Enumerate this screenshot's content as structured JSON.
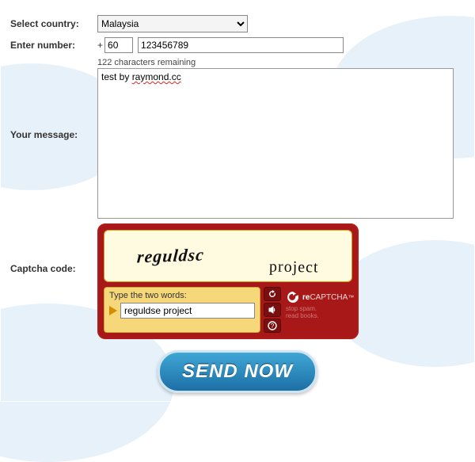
{
  "labels": {
    "country": "Select country:",
    "number": "Enter number:",
    "message": "Your message:",
    "captcha": "Captcha code:"
  },
  "country": {
    "selected": "Malaysia"
  },
  "number": {
    "plus": "+",
    "code": "60",
    "value": "123456789"
  },
  "message": {
    "remaining": "122 characters remaining",
    "text_prefix": "test by ",
    "text_err": "raymond.cc"
  },
  "captcha": {
    "word1": "reguldsc",
    "word2": "project",
    "prompt": "Type the two words:",
    "input": "reguldse project",
    "brand_re": "re",
    "brand_captcha": "CAPTCHA",
    "brand_tm": "™",
    "brand_tag1": "stop spam.",
    "brand_tag2": "read books."
  },
  "send": "SEND NOW"
}
